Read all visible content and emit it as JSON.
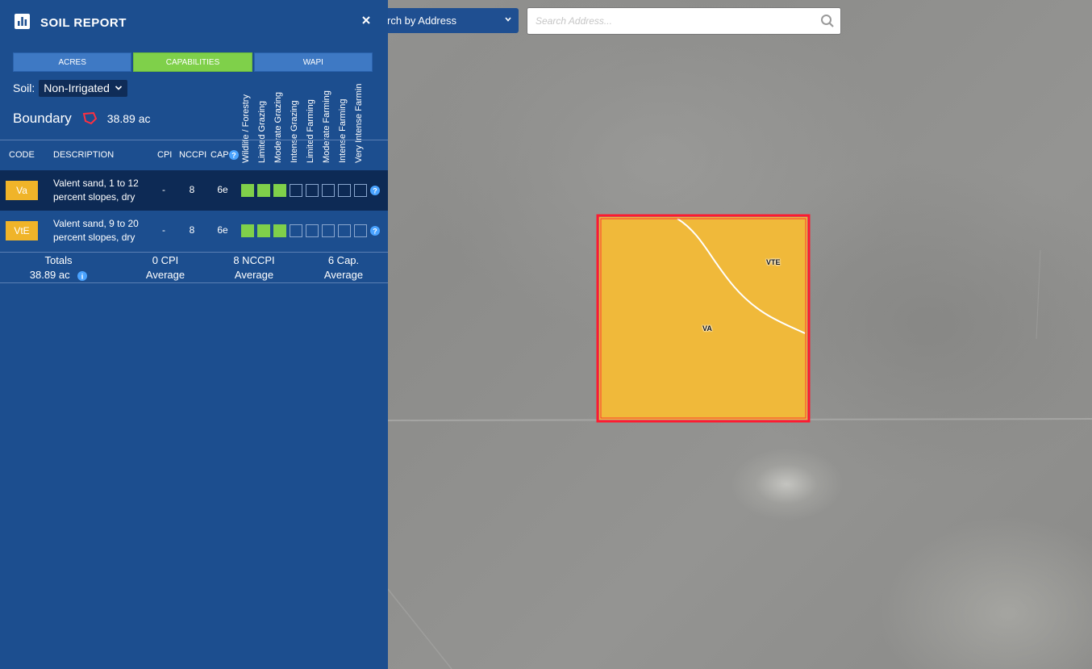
{
  "panel": {
    "title": "SOIL REPORT",
    "tabs": [
      {
        "label": "ACRES"
      },
      {
        "label": "CAPABILITIES"
      },
      {
        "label": "WAPI"
      }
    ],
    "active_tab": "CAPABILITIES",
    "soil_label": "Soil:",
    "soil_value": "Non-Irrigated",
    "boundary_label": "Boundary",
    "boundary_acres": "38.89 ac",
    "capability_headers": [
      "Wildlife / Forestry",
      "Limited Grazing",
      "Moderate Grazing",
      "Intense Grazing",
      "Limited Farming",
      "Moderate Farming",
      "Intense Farming",
      "Very Intense Farmin"
    ],
    "columns": {
      "code": "CODE",
      "description": "DESCRIPTION",
      "cpi": "CPI",
      "nccpi": "NCCPI",
      "cap": "CAP"
    },
    "rows": [
      {
        "code": "Va",
        "description": "Valent sand, 1 to 12 percent slopes, dry",
        "cpi": "-",
        "nccpi": "8",
        "cap": "6e",
        "capabilities_filled": 3
      },
      {
        "code": "VtE",
        "description": "Valent sand, 9 to 20 percent slopes, dry",
        "cpi": "-",
        "nccpi": "8",
        "cap": "6e",
        "capabilities_filled": 3
      }
    ],
    "totals": {
      "label": "Totals",
      "acres": "38.89 ac",
      "cpi_value": "0 CPI",
      "cpi_sub": "Average",
      "nccpi_value": "8 NCCPI",
      "nccpi_sub": "Average",
      "cap_value": "6 Cap.",
      "cap_sub": "Average"
    }
  },
  "search": {
    "type_label": "rch by Address",
    "placeholder": "Search Address..."
  },
  "map": {
    "parcel_labels": [
      "VTE",
      "VA"
    ],
    "soil_fill_color": "#f0b429",
    "boundary_color": "#ff1a2e"
  },
  "colors": {
    "panel_bg": "#1c4e8f",
    "active_tab": "#7fd04a",
    "tab": "#3e79c4",
    "badge": "#f0b429"
  }
}
